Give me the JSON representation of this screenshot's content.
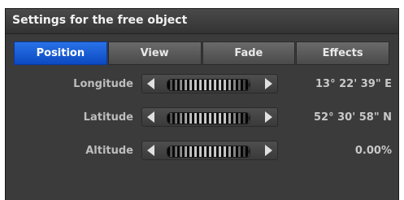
{
  "panel": {
    "title": "Settings for the free object"
  },
  "tabs": [
    {
      "label": "Position",
      "active": true
    },
    {
      "label": "View",
      "active": false
    },
    {
      "label": "Fade",
      "active": false
    },
    {
      "label": "Effects",
      "active": false
    }
  ],
  "fields": {
    "longitude": {
      "label": "Longitude",
      "value": "13° 22' 39\" E"
    },
    "latitude": {
      "label": "Latitude",
      "value": "52° 30' 58\" N"
    },
    "altitude": {
      "label": "Altitude",
      "value": "0.00%"
    }
  },
  "colors": {
    "panel_bg": "#3b3b3b",
    "active_tab": "#1a5fd6",
    "text": "#bdbdbd"
  },
  "icons": {
    "decrement": "arrow-left-icon",
    "increment": "arrow-right-icon",
    "dial": "jog-dial-icon"
  }
}
